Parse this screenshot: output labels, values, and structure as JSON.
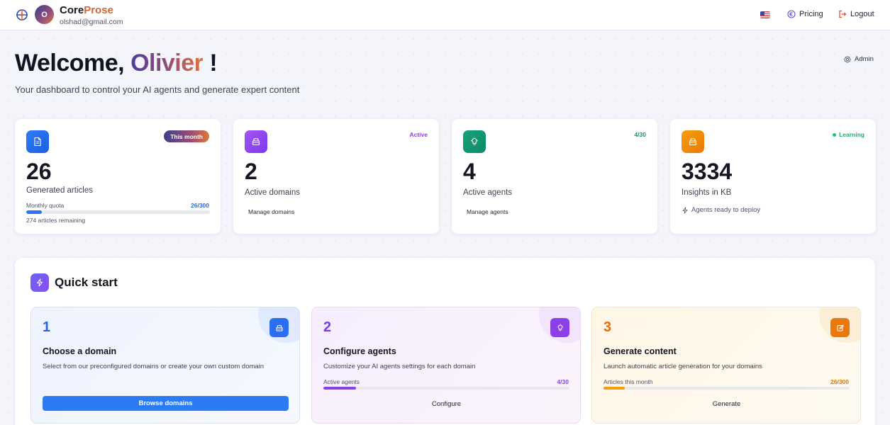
{
  "header": {
    "avatar_initial": "O",
    "brand_part1": "Core",
    "brand_part2": "Prose",
    "email": "olshad@gmail.com",
    "pricing_label": "Pricing",
    "logout_label": "Logout"
  },
  "welcome": {
    "greeting": "Welcome,",
    "name": "Olivier",
    "exclaim": "!",
    "subtitle": "Your dashboard to control your AI agents and generate expert content",
    "admin_label": "Admin"
  },
  "stats": [
    {
      "badge": "This month",
      "value": "26",
      "label": "Generated articles",
      "quota_label": "Monthly quota",
      "quota_value": "26/300",
      "quota_fraction": 0.0867,
      "remaining": "274 articles remaining",
      "icon": "document-icon",
      "color": "#2f7cf6"
    },
    {
      "badge": "Active",
      "value": "2",
      "label": "Active domains",
      "link": "Manage domains",
      "icon": "package-icon",
      "color": "#8b3fe6"
    },
    {
      "badge": "4/30",
      "value": "4",
      "label": "Active agents",
      "link": "Manage agents",
      "icon": "lightbulb-icon",
      "color": "#16a37a"
    },
    {
      "badge": "Learning",
      "value": "3334",
      "label": "Insights in KB",
      "note": "Agents ready to deploy",
      "icon": "package-icon",
      "color": "#f59e0b"
    }
  ],
  "quick_start": {
    "title": "Quick start",
    "steps": [
      {
        "number": "1",
        "title": "Choose a domain",
        "description": "Select from our preconfigured domains or create your own custom domain",
        "button": "Browse domains",
        "icon": "package-icon"
      },
      {
        "number": "2",
        "title": "Configure agents",
        "description": "Customize your AI agents settings for each domain",
        "progress_label": "Active agents",
        "progress_value": "4/30",
        "progress_fraction": 0.1333,
        "button": "Configure",
        "icon": "lightbulb-icon"
      },
      {
        "number": "3",
        "title": "Generate content",
        "description": "Launch automatic article generation for your domains",
        "progress_label": "Articles this month",
        "progress_value": "26/300",
        "progress_fraction": 0.0867,
        "button": "Generate",
        "icon": "edit-icon"
      }
    ]
  },
  "colors": {
    "accent_blue": "#2c7bf5",
    "accent_purple": "#8b3fe6",
    "accent_orange": "#f59e0b",
    "accent_green": "#16a37a"
  }
}
